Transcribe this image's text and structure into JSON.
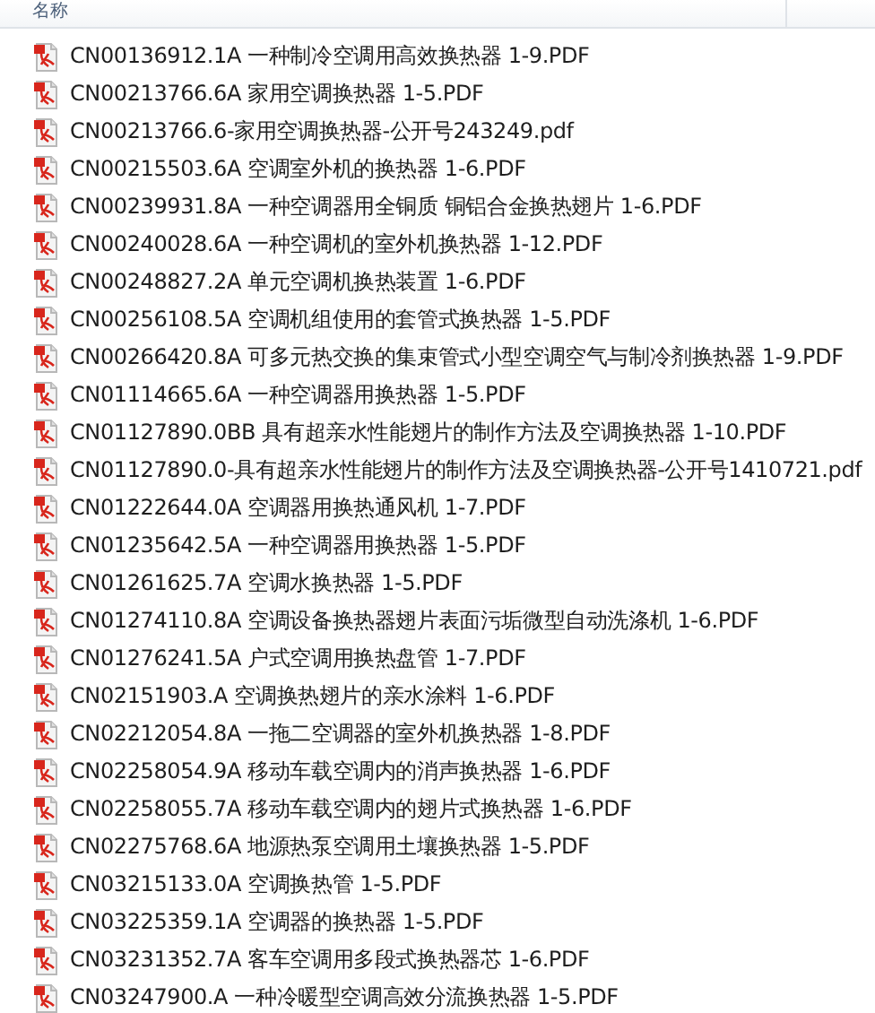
{
  "header": {
    "columns": [
      {
        "label": "名称"
      }
    ]
  },
  "files": [
    {
      "name": "CN00136912.1A 一种制冷空调用高效换热器 1-9.PDF"
    },
    {
      "name": "CN00213766.6A 家用空调换热器 1-5.PDF"
    },
    {
      "name": "CN00213766.6-家用空调换热器-公开号243249.pdf"
    },
    {
      "name": "CN00215503.6A 空调室外机的换热器 1-6.PDF"
    },
    {
      "name": "CN00239931.8A 一种空调器用全铜质 铜铝合金换热翅片 1-6.PDF"
    },
    {
      "name": "CN00240028.6A 一种空调机的室外机换热器 1-12.PDF"
    },
    {
      "name": "CN00248827.2A 单元空调机换热装置 1-6.PDF"
    },
    {
      "name": "CN00256108.5A 空调机组使用的套管式换热器 1-5.PDF"
    },
    {
      "name": "CN00266420.8A 可多元热交换的集束管式小型空调空气与制冷剂换热器 1-9.PDF"
    },
    {
      "name": "CN01114665.6A 一种空调器用换热器 1-5.PDF"
    },
    {
      "name": "CN01127890.0BB 具有超亲水性能翅片的制作方法及空调换热器 1-10.PDF"
    },
    {
      "name": "CN01127890.0-具有超亲水性能翅片的制作方法及空调换热器-公开号1410721.pdf"
    },
    {
      "name": "CN01222644.0A 空调器用换热通风机 1-7.PDF"
    },
    {
      "name": "CN01235642.5A 一种空调器用换热器 1-5.PDF"
    },
    {
      "name": "CN01261625.7A 空调水换热器 1-5.PDF"
    },
    {
      "name": "CN01274110.8A 空调设备换热器翅片表面污垢微型自动洗涤机 1-6.PDF"
    },
    {
      "name": "CN01276241.5A 户式空调用换热盘管 1-7.PDF"
    },
    {
      "name": "CN02151903.A 空调换热翅片的亲水涂料 1-6.PDF"
    },
    {
      "name": "CN02212054.8A 一拖二空调器的室外机换热器 1-8.PDF"
    },
    {
      "name": "CN02258054.9A 移动车载空调内的消声换热器 1-6.PDF"
    },
    {
      "name": "CN02258055.7A 移动车载空调内的翅片式换热器 1-6.PDF"
    },
    {
      "name": "CN02275768.6A 地源热泵空调用土壤换热器 1-5.PDF"
    },
    {
      "name": "CN03215133.0A 空调换热管 1-5.PDF"
    },
    {
      "name": "CN03225359.1A 空调器的换热器 1-5.PDF"
    },
    {
      "name": "CN03231352.7A 客车空调用多段式换热器芯 1-6.PDF"
    },
    {
      "name": "CN03247900.A 一种冷暖型空调高效分流换热器 1-5.PDF"
    }
  ]
}
